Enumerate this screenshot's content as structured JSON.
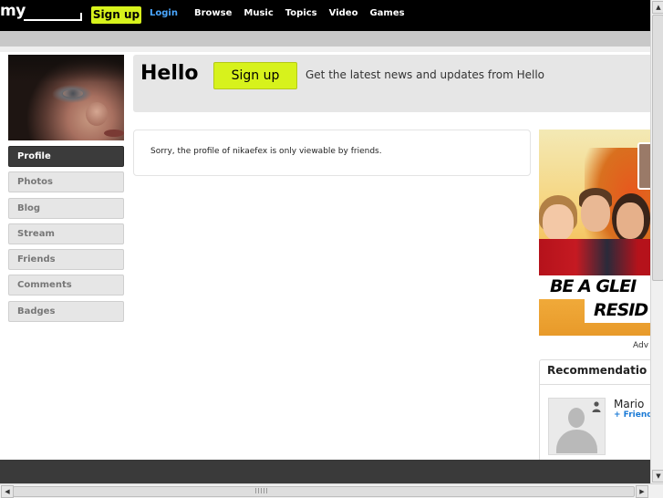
{
  "topbar": {
    "logo": "my",
    "signup_label": "Sign up",
    "login_label": "Login",
    "nav": [
      "Browse",
      "Music",
      "Topics",
      "Video",
      "Games"
    ]
  },
  "sidebar": {
    "items": [
      {
        "label": "Profile",
        "active": true
      },
      {
        "label": "Photos"
      },
      {
        "label": "Blog"
      },
      {
        "label": "Stream"
      },
      {
        "label": "Friends"
      },
      {
        "label": "Comments"
      },
      {
        "label": "Badges"
      }
    ]
  },
  "hello": {
    "title": "Hello",
    "signup_label": "Sign up",
    "tagline": "Get the latest news and updates from Hello"
  },
  "message": "Sorry, the profile of nikaefex is only viewable by friends.",
  "ad": {
    "line1": "BE A GLEI",
    "line2": "RESID",
    "label": "Adv"
  },
  "recommendations": {
    "title": "Recommendatio",
    "items": [
      {
        "name": "Mario",
        "action": "+ Friend"
      }
    ]
  },
  "colors": {
    "accent": "#d7f21c",
    "link": "#4aa7ff",
    "friend_link": "#1a7ad6",
    "active_nav": "#3b3b3b"
  },
  "icons": {
    "sidebar_profile": "profile-photo",
    "rec_user": "user-icon",
    "placeholder": "silhouette-placeholder"
  }
}
